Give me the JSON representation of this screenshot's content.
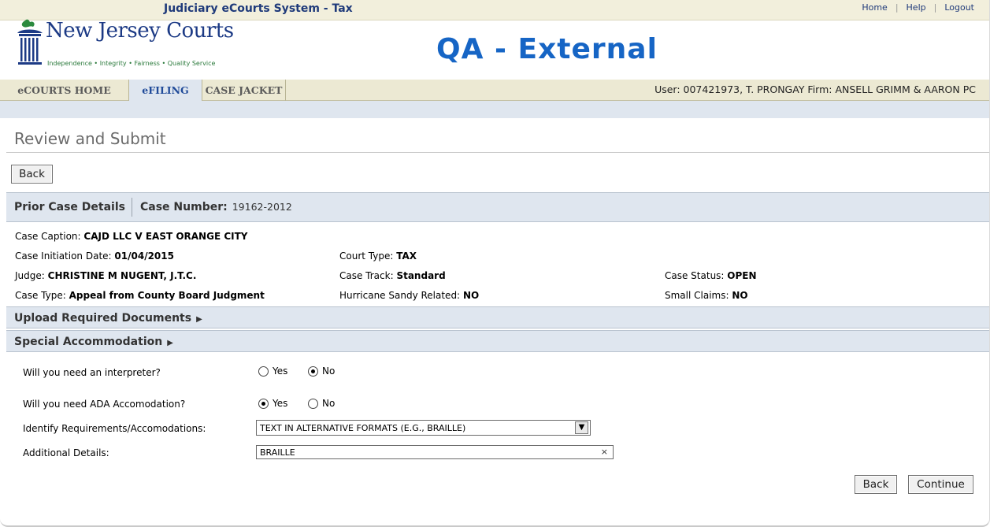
{
  "system": {
    "title": "Judiciary eCourts System - Tax",
    "links": [
      "Home",
      "Help",
      "Logout"
    ]
  },
  "logo": {
    "title": "New Jersey Courts",
    "tagline": "Independence • Integrity • Fairness • Quality Service"
  },
  "environment": "QA - External",
  "tabs": [
    {
      "label": "eCOURTS HOME",
      "active": false
    },
    {
      "label": "eFILING",
      "active": true
    },
    {
      "label": "CASE JACKET",
      "active": false
    }
  ],
  "user_info": "User: 007421973, T. PRONGAY  Firm: ANSELL GRIMM & AARON PC",
  "page_title": "Review and Submit",
  "buttons": {
    "back": "Back",
    "continue": "Continue"
  },
  "prior_case": {
    "heading": "Prior Case Details",
    "case_number_label": "Case Number:",
    "case_number": "19162-2012",
    "caption_label": "Case Caption:",
    "caption": "CAJD LLC V EAST ORANGE CITY",
    "initiation_label": "Case Initiation Date:",
    "initiation": "01/04/2015",
    "court_type_label": "Court Type:",
    "court_type": "TAX",
    "judge_label": "Judge:",
    "judge": "CHRISTINE M NUGENT, J.T.C.",
    "track_label": "Case Track:",
    "track": "Standard",
    "status_label": "Case Status:",
    "status": "OPEN",
    "type_label": "Case Type:",
    "type": "Appeal from County Board Judgment",
    "sandy_label": "Hurricane Sandy Related:",
    "sandy": "NO",
    "small_claims_label": "Small Claims:",
    "small_claims": "NO"
  },
  "upload_section": "Upload Required Documents",
  "special_section": "Special Accommodation",
  "accommodation": {
    "interpreter_q": "Will you need an interpreter?",
    "interpreter_value": "No",
    "ada_q": "Will you need ADA Accomodation?",
    "ada_value": "Yes",
    "yes_label": "Yes",
    "no_label": "No",
    "requirements_label": "Identify Requirements/Accomodations:",
    "requirements_value": "TEXT IN ALTERNATIVE FORMATS (E.G., BRAILLE)",
    "details_label": "Additional Details:",
    "details_value": "BRAILLE"
  },
  "colors": {
    "header_bg": "#f2efdc",
    "section_bg": "#dfe6ef",
    "brand_blue": "#1c3a85",
    "env_blue": "#1665c5"
  }
}
